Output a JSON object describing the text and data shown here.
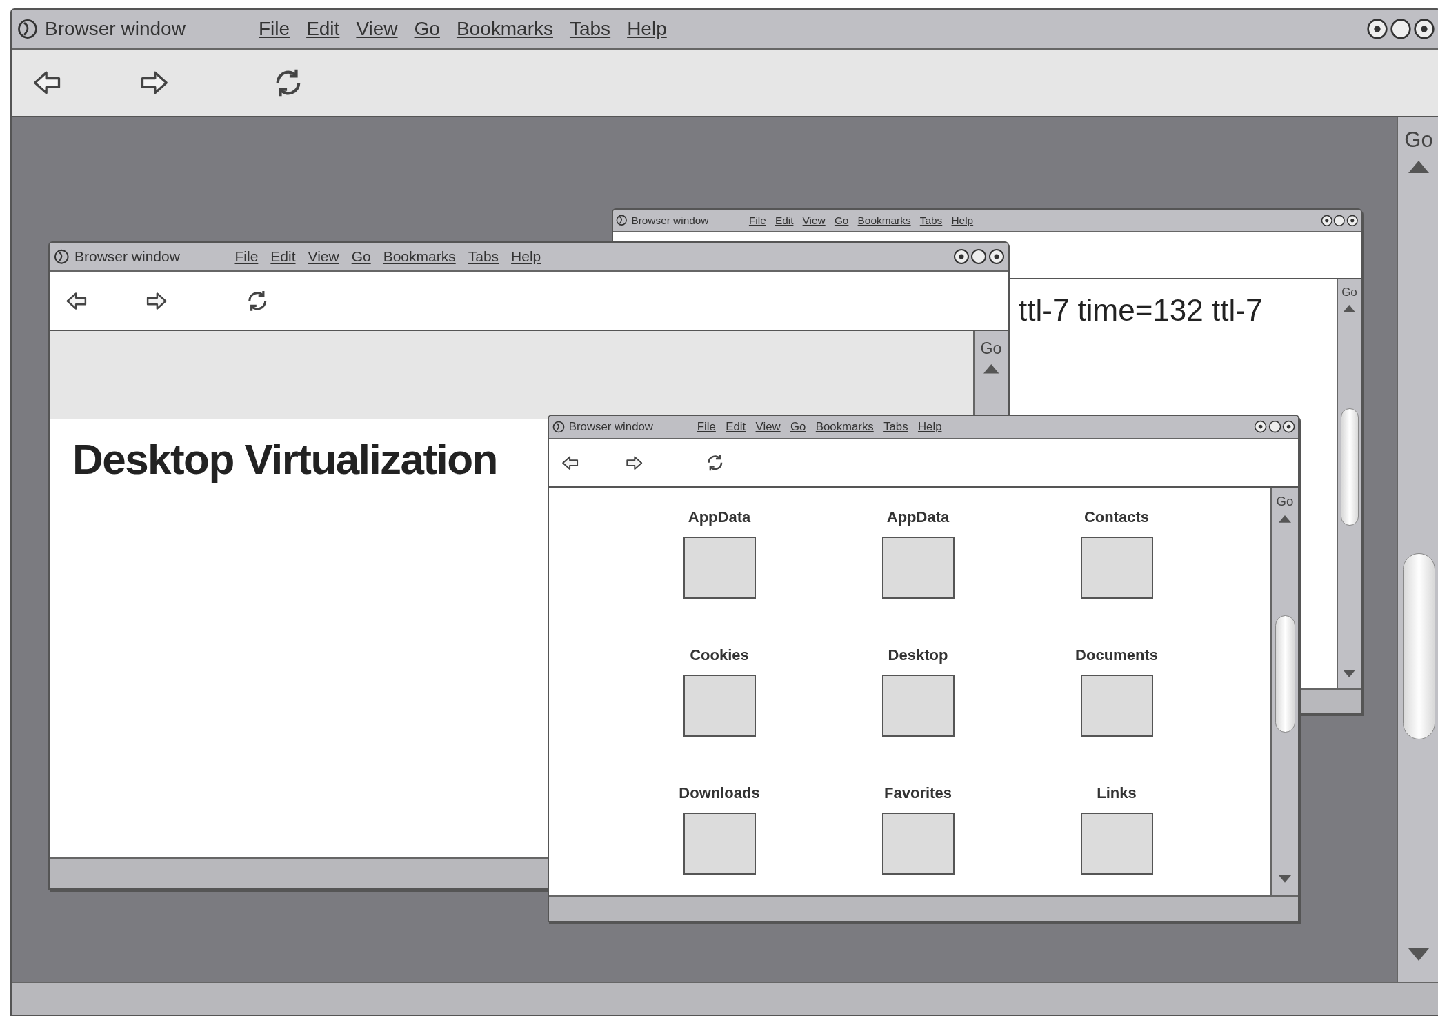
{
  "windows": [
    {
      "title": "Browser window",
      "menu": [
        "File",
        "Edit",
        "View",
        "Go",
        "Bookmarks",
        "Tabs",
        "Help"
      ],
      "scrollbar_label": "Go",
      "content": {
        "kind": "blank"
      }
    },
    {
      "title": "Browser window",
      "menu": [
        "File",
        "Edit",
        "View",
        "Go",
        "Bookmarks",
        "Tabs",
        "Help"
      ],
      "scrollbar_label": "Go",
      "content": {
        "kind": "text",
        "text": "ttl-7 time=132 ttl-7"
      }
    },
    {
      "title": "Browser window",
      "menu": [
        "File",
        "Edit",
        "View",
        "Go",
        "Bookmarks",
        "Tabs",
        "Help"
      ],
      "scrollbar_label": "Go",
      "content": {
        "kind": "heading",
        "text": "Desktop Virtualization"
      }
    },
    {
      "title": "Browser window",
      "menu": [
        "File",
        "Edit",
        "View",
        "Go",
        "Bookmarks",
        "Tabs",
        "Help"
      ],
      "scrollbar_label": "Go",
      "content": {
        "kind": "folders",
        "items": [
          "AppData",
          "AppData",
          "Contacts",
          "Cookies",
          "Desktop",
          "Documents",
          "Downloads",
          "Favorites",
          "Links"
        ]
      }
    }
  ]
}
